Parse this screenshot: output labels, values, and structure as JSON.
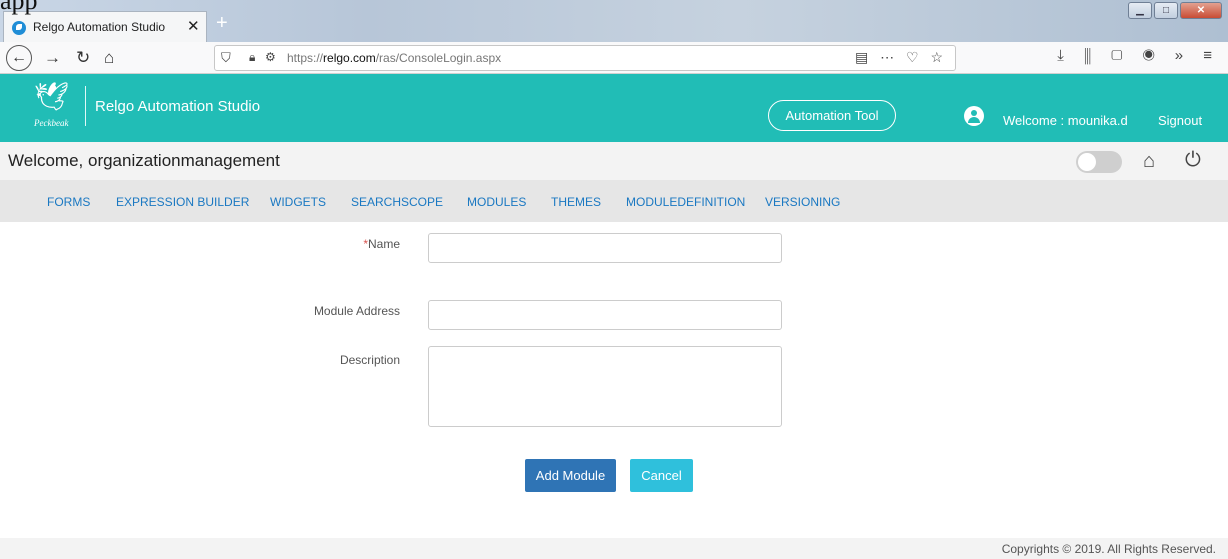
{
  "artifact_text": "app",
  "browser": {
    "tab_title": "Relgo Automation Studio",
    "tab_close": "✕",
    "new_tab": "+",
    "url_prefix": "https://",
    "url_domain": "relgo.com",
    "url_path": "/ras/ConsoleLogin.aspx"
  },
  "header": {
    "logo_text": "Peckbeak",
    "app_title": "Relgo Automation Studio",
    "automation_tool_label": "Automation Tool",
    "welcome_user": "Welcome : mounika.d",
    "signout_label": "Signout"
  },
  "welcome": {
    "text": "Welcome, organizationmanagement"
  },
  "menu": {
    "items": [
      {
        "label": "FORMS"
      },
      {
        "label": "EXPRESSION BUILDER"
      },
      {
        "label": "WIDGETS"
      },
      {
        "label": "SEARCHSCOPE"
      },
      {
        "label": "MODULES"
      },
      {
        "label": "THEMES"
      },
      {
        "label": "MODULEDEFINITION"
      },
      {
        "label": "VERSIONING"
      }
    ]
  },
  "form": {
    "name_required_mark": "*",
    "name_label": "Name",
    "name_value": "",
    "module_address_label": "Module Address",
    "module_address_value": "",
    "description_label": "Description",
    "description_value": "",
    "add_button": "Add Module",
    "cancel_button": "Cancel"
  },
  "footer": {
    "copyright": "Copyrights © 2019. All Rights Reserved."
  },
  "colors": {
    "header_teal": "#21bdb6",
    "menu_link": "#1a78c2",
    "add_button": "#2f74b5",
    "cancel_button": "#2fc0dc"
  }
}
